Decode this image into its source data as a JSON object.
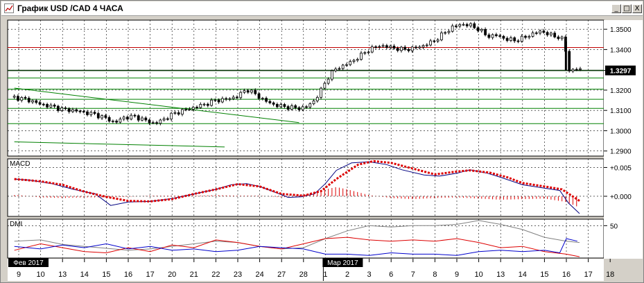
{
  "window": {
    "title": "График USD /CAD  4 ЧАСА",
    "buttons": {
      "minimize": "_",
      "restore": "□",
      "close": "X"
    },
    "icon": "chart-icon"
  },
  "colors": {
    "background": "#ffffff",
    "frame": "#d4d0c8",
    "candles": "#000000",
    "resistance_line": "#c00000",
    "support_lines": "#008000",
    "current_price_line": "#003000",
    "macd_line": "#000080",
    "signal_line": "#dd0000",
    "histogram": "#dd0000",
    "dmi_plus": "#dd0000",
    "dmi_minus": "#0000cc",
    "adx": "#808080",
    "price_label_bg": "#000000",
    "date_label_bg": "#000000"
  },
  "chart_data": {
    "type": "candlestick",
    "symbol": "USD/CAD",
    "timeframe": "4 ЧАСА",
    "price_axis": {
      "ticks": [
        "1.3500",
        "1.3400",
        "1.3297",
        "1.3200",
        "1.3100",
        "1.3000",
        "1.2900"
      ],
      "ylim": [
        1.2875,
        1.3545
      ]
    },
    "current_price": {
      "value": 1.3297,
      "label": "1.3297"
    },
    "x_axis": {
      "labels": [
        "9",
        "10",
        "13",
        "14",
        "15",
        "16",
        "17",
        "20",
        "21",
        "22",
        "23",
        "24",
        "27",
        "28",
        "1",
        "2",
        "3",
        "6",
        "7",
        "8",
        "9",
        "10",
        "13",
        "14",
        "15",
        "16",
        "17",
        "18"
      ],
      "month_labels": [
        {
          "text": "Фев 2017",
          "at_day": "9"
        },
        {
          "text": "Мар 2017",
          "at_day": "1"
        }
      ],
      "major_separator_at_index": 14
    },
    "horizontal_levels": [
      {
        "name": "resistance",
        "value": 1.341,
        "color": "#c00000"
      },
      {
        "name": "current",
        "value": 1.3297,
        "color": "#003000"
      },
      {
        "name": "support-1",
        "value": 1.326,
        "color": "#008000"
      },
      {
        "name": "support-2",
        "value": 1.3205,
        "color": "#008000"
      },
      {
        "name": "support-3",
        "value": 1.3155,
        "color": "#008000"
      },
      {
        "name": "support-4",
        "value": 1.311,
        "color": "#008000"
      },
      {
        "name": "support-5",
        "value": 1.3035,
        "color": "#008000"
      }
    ],
    "trend_lines": [
      {
        "from": {
          "x_index": -0.2,
          "y": 1.321
        },
        "to": {
          "x_index": 12.8,
          "y": 1.304
        },
        "color": "#008000"
      },
      {
        "from": {
          "x_index": -0.2,
          "y": 1.2945
        },
        "to": {
          "x_index": 9.4,
          "y": 1.292
        },
        "color": "#008000"
      }
    ],
    "close_path": [
      [
        -0.2,
        1.3165
      ],
      [
        0.5,
        1.315
      ],
      [
        1.0,
        1.313
      ],
      [
        1.5,
        1.312
      ],
      [
        2.0,
        1.3105
      ],
      [
        2.5,
        1.31
      ],
      [
        3.0,
        1.309
      ],
      [
        3.5,
        1.308
      ],
      [
        4.0,
        1.306
      ],
      [
        4.4,
        1.304
      ],
      [
        4.8,
        1.3065
      ],
      [
        5.3,
        1.307
      ],
      [
        5.8,
        1.305
      ],
      [
        6.2,
        1.3035
      ],
      [
        6.6,
        1.3055
      ],
      [
        7.0,
        1.308
      ],
      [
        7.5,
        1.31
      ],
      [
        8.0,
        1.3115
      ],
      [
        8.5,
        1.313
      ],
      [
        9.0,
        1.315
      ],
      [
        9.5,
        1.3155
      ],
      [
        10.0,
        1.317
      ],
      [
        10.4,
        1.3205
      ],
      [
        10.8,
        1.318
      ],
      [
        11.2,
        1.315
      ],
      [
        11.6,
        1.313
      ],
      [
        12.0,
        1.312
      ],
      [
        12.4,
        1.3115
      ],
      [
        12.8,
        1.311
      ],
      [
        13.2,
        1.312
      ],
      [
        13.5,
        1.315
      ],
      [
        13.8,
        1.32
      ],
      [
        14.1,
        1.326
      ],
      [
        14.4,
        1.33
      ],
      [
        14.8,
        1.332
      ],
      [
        15.2,
        1.334
      ],
      [
        15.6,
        1.337
      ],
      [
        16.0,
        1.34
      ],
      [
        16.5,
        1.342
      ],
      [
        17.0,
        1.341
      ],
      [
        17.5,
        1.34
      ],
      [
        18.0,
        1.3405
      ],
      [
        18.5,
        1.342
      ],
      [
        19.0,
        1.3445
      ],
      [
        19.4,
        1.348
      ],
      [
        19.8,
        1.351
      ],
      [
        20.2,
        1.3525
      ],
      [
        20.6,
        1.352
      ],
      [
        21.0,
        1.35
      ],
      [
        21.4,
        1.3465
      ],
      [
        21.8,
        1.347
      ],
      [
        22.3,
        1.345
      ],
      [
        22.7,
        1.3445
      ],
      [
        23.1,
        1.346
      ],
      [
        23.5,
        1.348
      ],
      [
        23.9,
        1.349
      ],
      [
        24.3,
        1.347
      ],
      [
        24.7,
        1.346
      ],
      [
        24.95,
        1.344
      ],
      [
        25.0,
        1.33
      ],
      [
        25.2,
        1.3297
      ],
      [
        25.5,
        1.3305
      ],
      [
        25.7,
        1.3297
      ]
    ],
    "indicators": {
      "macd": {
        "title": "MACD",
        "ticks": [
          "+0.005",
          "+0.000"
        ],
        "ylim": [
          -0.0035,
          0.0065
        ],
        "macd_line": [
          [
            -0.2,
            0.003
          ],
          [
            0.5,
            0.0028
          ],
          [
            1.5,
            0.0022
          ],
          [
            2.5,
            0.0012
          ],
          [
            3.5,
            0.0004
          ],
          [
            4.2,
            -0.0016
          ],
          [
            5.0,
            -0.001
          ],
          [
            6.0,
            -0.0009
          ],
          [
            7.0,
            -0.0004
          ],
          [
            8.0,
            0.0004
          ],
          [
            9.0,
            0.0012
          ],
          [
            9.7,
            0.002
          ],
          [
            10.4,
            0.0022
          ],
          [
            11.0,
            0.0017
          ],
          [
            11.7,
            0.0007
          ],
          [
            12.3,
            -0.0002
          ],
          [
            12.9,
            -0.0001
          ],
          [
            13.5,
            0.0004
          ],
          [
            14.0,
            0.0022
          ],
          [
            14.5,
            0.0045
          ],
          [
            15.2,
            0.0058
          ],
          [
            16.0,
            0.006
          ],
          [
            16.8,
            0.0055
          ],
          [
            17.5,
            0.0046
          ],
          [
            18.5,
            0.0037
          ],
          [
            19.2,
            0.0035
          ],
          [
            20.0,
            0.004
          ],
          [
            20.6,
            0.0046
          ],
          [
            21.4,
            0.004
          ],
          [
            22.0,
            0.0033
          ],
          [
            23.0,
            0.002
          ],
          [
            24.0,
            0.0014
          ],
          [
            24.7,
            0.001
          ],
          [
            25.1,
            -0.0012
          ],
          [
            25.6,
            -0.003
          ]
        ],
        "signal_line": [
          [
            -0.2,
            0.003
          ],
          [
            1.0,
            0.0026
          ],
          [
            2.0,
            0.002
          ],
          [
            3.0,
            0.0008
          ],
          [
            4.0,
            -0.0001
          ],
          [
            5.0,
            -0.0008
          ],
          [
            6.0,
            -0.0009
          ],
          [
            7.0,
            -0.0005
          ],
          [
            8.0,
            0.0004
          ],
          [
            9.0,
            0.0012
          ],
          [
            10.0,
            0.0021
          ],
          [
            11.0,
            0.0017
          ],
          [
            12.0,
            0.0004
          ],
          [
            13.0,
            0.0001
          ],
          [
            13.8,
            0.0009
          ],
          [
            14.5,
            0.003
          ],
          [
            15.5,
            0.0055
          ],
          [
            16.2,
            0.0061
          ],
          [
            17.0,
            0.0058
          ],
          [
            18.0,
            0.0048
          ],
          [
            19.0,
            0.0038
          ],
          [
            20.0,
            0.0043
          ],
          [
            20.6,
            0.0045
          ],
          [
            21.5,
            0.0041
          ],
          [
            22.3,
            0.0033
          ],
          [
            23.0,
            0.0023
          ],
          [
            24.0,
            0.0017
          ],
          [
            24.8,
            0.0012
          ],
          [
            25.2,
            0.0002
          ],
          [
            25.6,
            -0.0008
          ]
        ],
        "histogram": [
          [
            0,
            0.0002
          ],
          [
            1,
            -0.0002
          ],
          [
            2,
            -0.0003
          ],
          [
            3,
            -0.0002
          ],
          [
            4,
            -0.0002
          ],
          [
            5,
            -0.0001
          ],
          [
            6,
            0.0001
          ],
          [
            7,
            0.0001
          ],
          [
            8,
            0.0001
          ],
          [
            9,
            0.0002
          ],
          [
            10,
            0.0001
          ],
          [
            11,
            0.0001
          ],
          [
            12,
            -0.0002
          ],
          [
            13,
            0.0002
          ],
          [
            14,
            0.0012
          ],
          [
            14.5,
            0.0016
          ],
          [
            15,
            0.0012
          ],
          [
            16,
            0.0002
          ],
          [
            17,
            -0.0003
          ],
          [
            18,
            -0.0005
          ],
          [
            19,
            -0.0003
          ],
          [
            20,
            -0.0002
          ],
          [
            21,
            -0.0004
          ],
          [
            22,
            -0.0006
          ],
          [
            23,
            -0.0005
          ],
          [
            24,
            -0.0004
          ],
          [
            25,
            -0.001
          ],
          [
            25.5,
            -0.0018
          ]
        ]
      },
      "dmi": {
        "title": "DMI",
        "ticks": [
          "50"
        ],
        "ylim": [
          0,
          60
        ],
        "adx": [
          [
            -0.2,
            26
          ],
          [
            1.0,
            28
          ],
          [
            2.0,
            21
          ],
          [
            3.0,
            18
          ],
          [
            4.0,
            15
          ],
          [
            5.0,
            12
          ],
          [
            6.0,
            14
          ],
          [
            7.0,
            18
          ],
          [
            8.0,
            22
          ],
          [
            9.0,
            26
          ],
          [
            10.0,
            24
          ],
          [
            11.0,
            18
          ],
          [
            12.0,
            14
          ],
          [
            13.0,
            16
          ],
          [
            14.0,
            30
          ],
          [
            15.0,
            42
          ],
          [
            16.0,
            50
          ],
          [
            17.0,
            48
          ],
          [
            18.0,
            50
          ],
          [
            19.0,
            50
          ],
          [
            20.0,
            52
          ],
          [
            21.0,
            58
          ],
          [
            22.0,
            52
          ],
          [
            23.0,
            44
          ],
          [
            24.0,
            32
          ],
          [
            25.0,
            26
          ],
          [
            25.6,
            24
          ]
        ],
        "plus_di": [
          [
            -0.2,
            12
          ],
          [
            1.0,
            22
          ],
          [
            2.0,
            16
          ],
          [
            3.0,
            10
          ],
          [
            4.0,
            8
          ],
          [
            5.0,
            16
          ],
          [
            6.0,
            10
          ],
          [
            7.0,
            20
          ],
          [
            8.0,
            16
          ],
          [
            9.0,
            28
          ],
          [
            10.0,
            24
          ],
          [
            11.0,
            18
          ],
          [
            12.0,
            14
          ],
          [
            13.0,
            22
          ],
          [
            14.0,
            30
          ],
          [
            15.0,
            32
          ],
          [
            16.0,
            28
          ],
          [
            17.0,
            26
          ],
          [
            18.0,
            28
          ],
          [
            19.0,
            26
          ],
          [
            20.0,
            30
          ],
          [
            21.0,
            24
          ],
          [
            22.0,
            16
          ],
          [
            23.0,
            18
          ],
          [
            24.0,
            10
          ],
          [
            25.0,
            6
          ],
          [
            25.6,
            2
          ]
        ],
        "minus_di": [
          [
            -0.2,
            18
          ],
          [
            1.0,
            14
          ],
          [
            2.0,
            20
          ],
          [
            3.0,
            16
          ],
          [
            4.0,
            22
          ],
          [
            5.0,
            14
          ],
          [
            6.0,
            18
          ],
          [
            7.0,
            12
          ],
          [
            8.0,
            14
          ],
          [
            9.0,
            10
          ],
          [
            10.0,
            12
          ],
          [
            11.0,
            18
          ],
          [
            12.0,
            16
          ],
          [
            13.0,
            14
          ],
          [
            14.0,
            6
          ],
          [
            15.0,
            6
          ],
          [
            16.0,
            4
          ],
          [
            17.0,
            8
          ],
          [
            18.0,
            6
          ],
          [
            19.0,
            6
          ],
          [
            20.0,
            4
          ],
          [
            21.0,
            10
          ],
          [
            22.0,
            12
          ],
          [
            23.0,
            10
          ],
          [
            24.0,
            12
          ],
          [
            24.7,
            8
          ],
          [
            25.0,
            30
          ],
          [
            25.5,
            26
          ]
        ]
      }
    }
  }
}
